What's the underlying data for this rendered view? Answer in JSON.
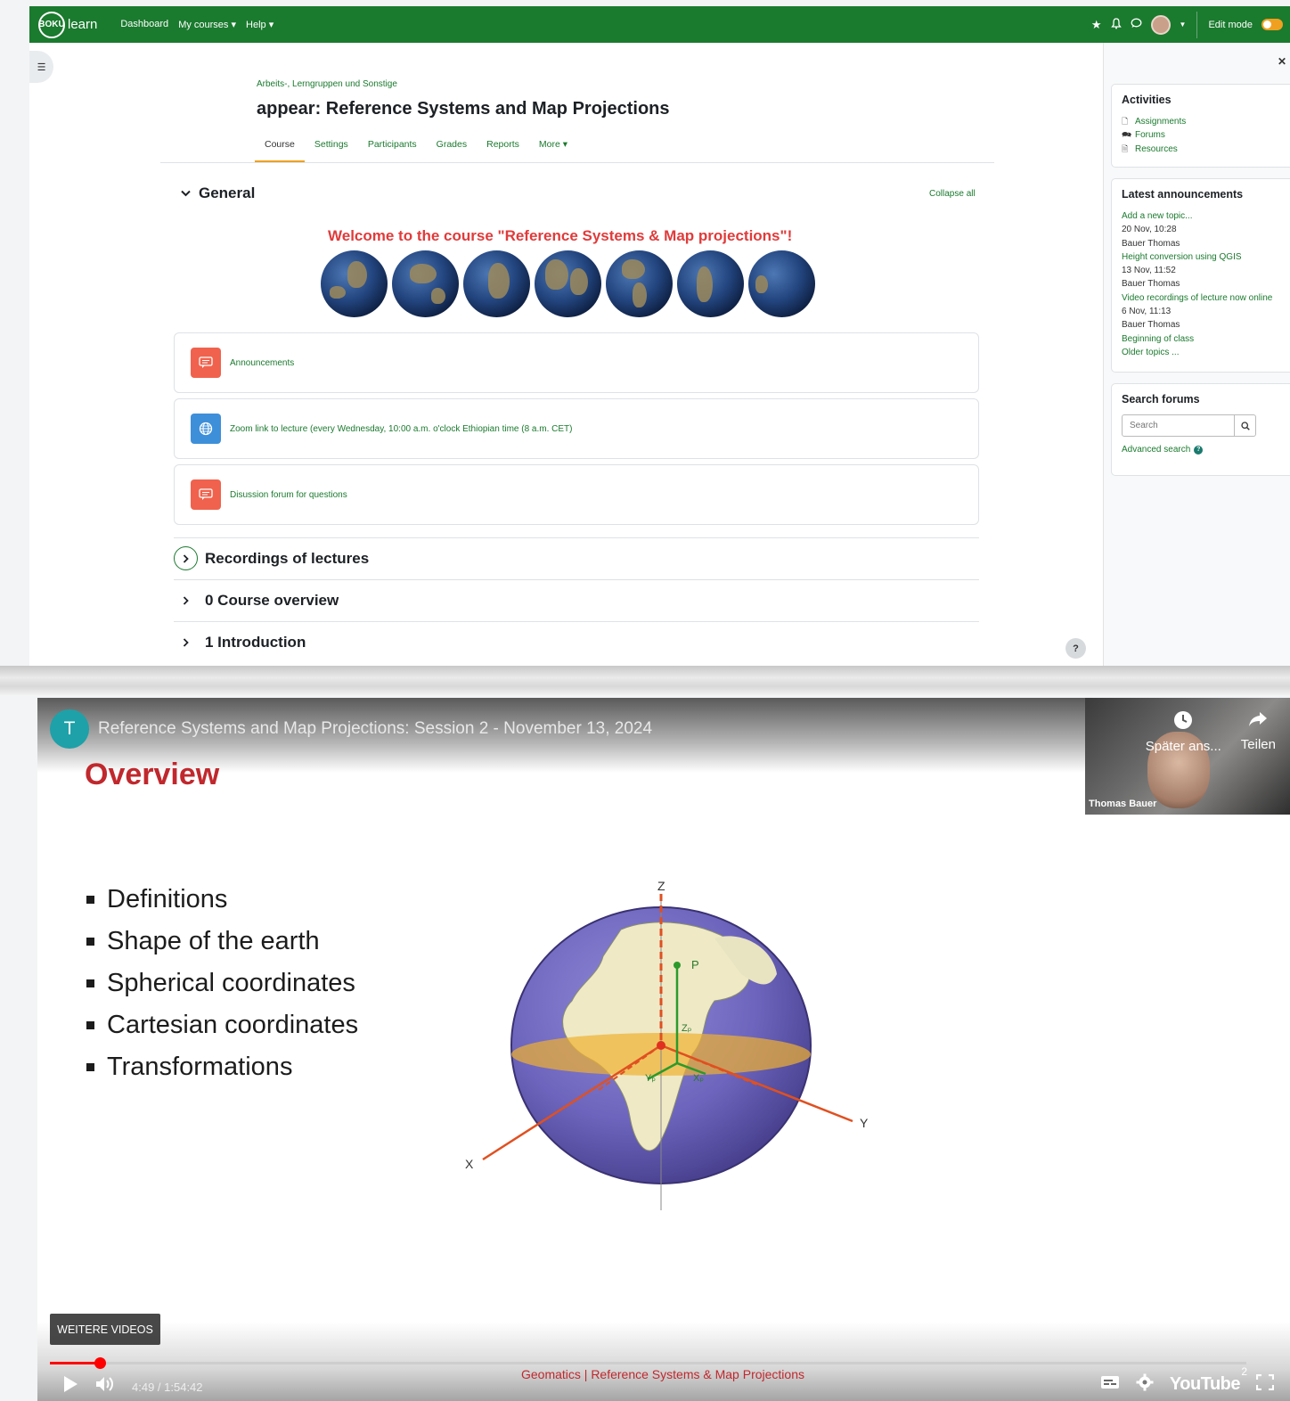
{
  "moodle": {
    "logo_text": "learn",
    "logo_badge": "BOKU",
    "nav_links": [
      "Dashboard",
      "My courses ▾",
      "Help ▾"
    ],
    "edit_mode_label": "Edit mode",
    "breadcrumb": "Arbeits-, Lerngruppen und Sonstige",
    "course_title": "appear: Reference Systems and Map Projections",
    "tabs": [
      "Course",
      "Settings",
      "Participants",
      "Grades",
      "Reports",
      "More ▾"
    ],
    "active_tab": "Course",
    "general_title": "General",
    "collapse_all": "Collapse all",
    "welcome": "Welcome to the course \"Reference Systems & Map projections\"!",
    "activities": [
      {
        "label": "Announcements",
        "icon": "forum-icon"
      },
      {
        "label": "Zoom link to lecture (every Wednesday, 10:00 a.m. o'clock Ethiopian time (8 a.m. CET)",
        "icon": "globe-icon"
      },
      {
        "label": "Disussion forum for questions",
        "icon": "forum-icon"
      }
    ],
    "sections": [
      "Recordings of lectures",
      "0 Course overview",
      "1 Introduction"
    ],
    "help_button": "?"
  },
  "drawer": {
    "activities_title": "Activities",
    "activities_links": [
      "Assignments",
      "Forums",
      "Resources"
    ],
    "announcements_title": "Latest announcements",
    "add_topic": "Add a new topic...",
    "announcements": [
      {
        "date": "20 Nov, 10:28",
        "author": "Bauer Thomas",
        "title": "Height conversion using QGIS"
      },
      {
        "date": "13 Nov, 11:52",
        "author": "Bauer Thomas",
        "title": "Video recordings of lecture now online"
      },
      {
        "date": "6 Nov, 11:13",
        "author": "Bauer Thomas",
        "title": "Beginning of class"
      }
    ],
    "older_topics": "Older topics ...",
    "search_title": "Search forums",
    "search_placeholder": "Search",
    "advanced_search": "Advanced search"
  },
  "video": {
    "channel_initial": "T",
    "title": "Reference Systems and Map Projections: Session 2 - November 13, 2024",
    "watch_later": "Später ans...",
    "share": "Teilen",
    "presenter": "Thomas Bauer",
    "slide_title": "Overview",
    "bullets": [
      "Definitions",
      "Shape of the earth",
      "Spherical coordinates",
      "Cartesian coordinates",
      "Transformations"
    ],
    "axis_labels": {
      "z": "Z",
      "x": "X",
      "y": "Y",
      "p": "P",
      "zp": "Zₚ",
      "xp": "Xₚ",
      "yp": "Yₚ"
    },
    "more_videos": "WEITERE VIDEOS",
    "time": "4:49 / 1:54:42",
    "progress": 0.042,
    "footer_caption": "Geomatics |  Reference Systems & Map Projections",
    "youtube": "YouTube",
    "captions_badge": "2"
  },
  "colors": {
    "brand_green": "#1a7a2e",
    "accent_orange": "#f0a020",
    "welcome_red": "#e03b3b",
    "yt_red": "#ff0000"
  }
}
